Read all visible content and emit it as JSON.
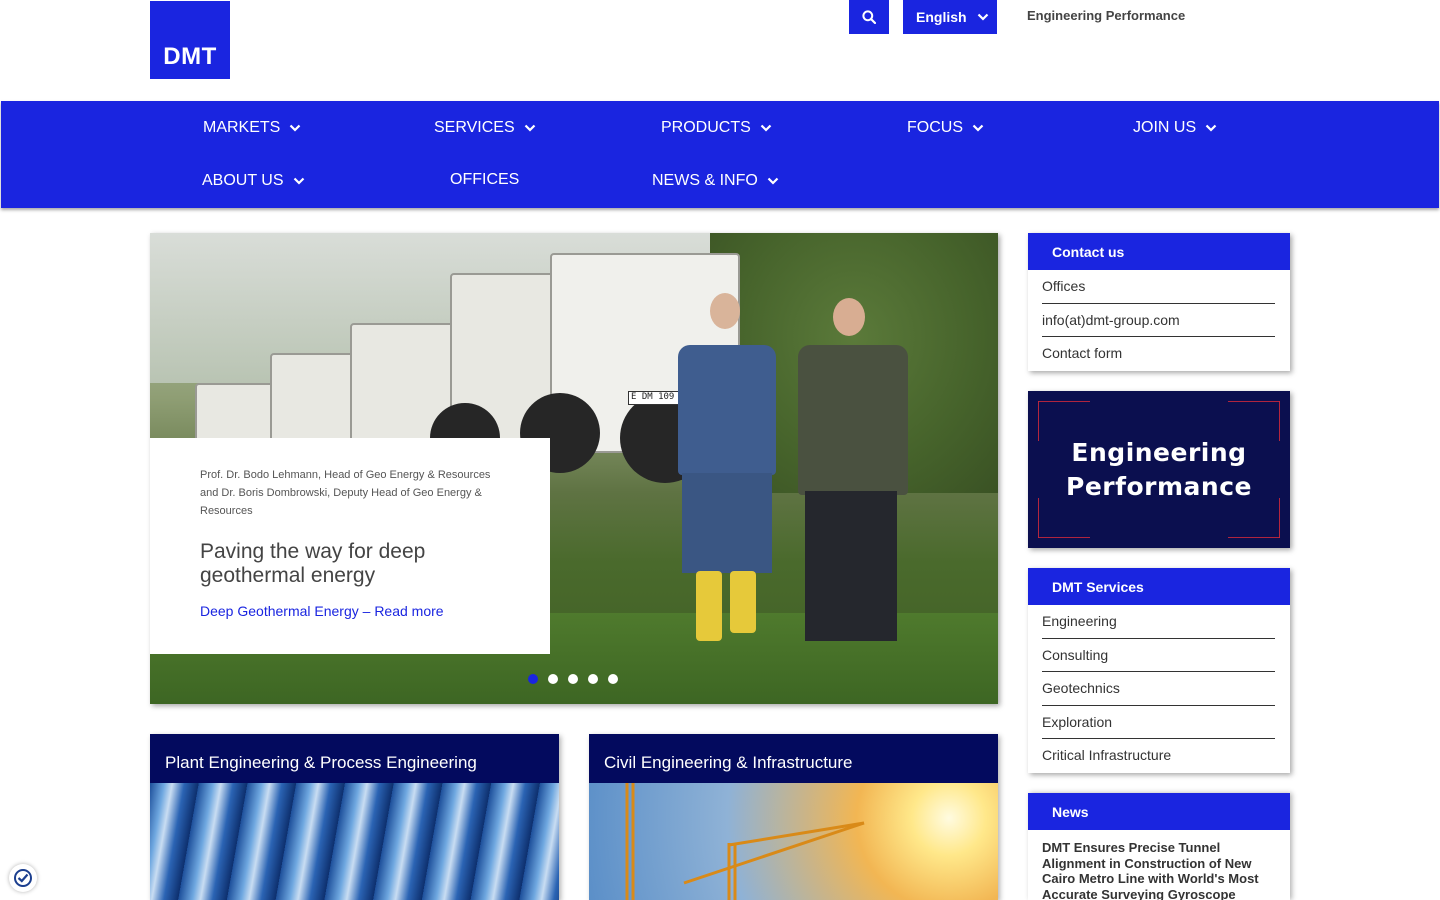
{
  "header": {
    "logo_text": "DMT",
    "language_label": "English",
    "engineering_performance_link": "Engineering Performance"
  },
  "nav": {
    "items": [
      {
        "label": "MARKETS",
        "has_dropdown": true
      },
      {
        "label": "SERVICES",
        "has_dropdown": true
      },
      {
        "label": "PRODUCTS",
        "has_dropdown": true
      },
      {
        "label": "FOCUS",
        "has_dropdown": true
      },
      {
        "label": "JOIN US",
        "has_dropdown": true
      },
      {
        "label": "ABOUT US",
        "has_dropdown": true
      },
      {
        "label": "OFFICES",
        "has_dropdown": false
      },
      {
        "label": "NEWS & INFO",
        "has_dropdown": true
      }
    ]
  },
  "hero": {
    "caption_small": "Prof. Dr. Bodo Lehmann, Head of Geo Energy & Resources and Dr. Boris Dombrowski, Deputy Head of Geo Energy & Resources",
    "title": "Paving the way for deep geothermal energy",
    "link": "Deep Geothermal Energy – Read more",
    "truck_plate": "E DM 109",
    "slides_total": 5,
    "active_slide": 1
  },
  "tiles": [
    {
      "title": "Plant Engineering & Process Engineering"
    },
    {
      "title": "Civil Engineering & Infrastructure"
    }
  ],
  "sidebar": {
    "contact": {
      "title": "Contact us",
      "items": [
        "Offices",
        "info(at)dmt-group.com",
        "Contact form"
      ]
    },
    "banner": {
      "line1": "Engineering",
      "line2": "Performance"
    },
    "services": {
      "title": "DMT Services",
      "items": [
        "Engineering",
        "Consulting",
        "Geotechnics",
        "Exploration",
        "Critical Infrastructure"
      ]
    },
    "news": {
      "title": "News",
      "headline": "DMT Ensures Precise Tunnel Alignment in Construction of New Cairo Metro Line with World's Most Accurate Surveying Gyroscope"
    }
  },
  "colors": {
    "brand_blue": "#1a25e0",
    "dark_navy": "#030a5e",
    "banner_navy": "#0b0f4f",
    "banner_accent": "#c8283c"
  }
}
